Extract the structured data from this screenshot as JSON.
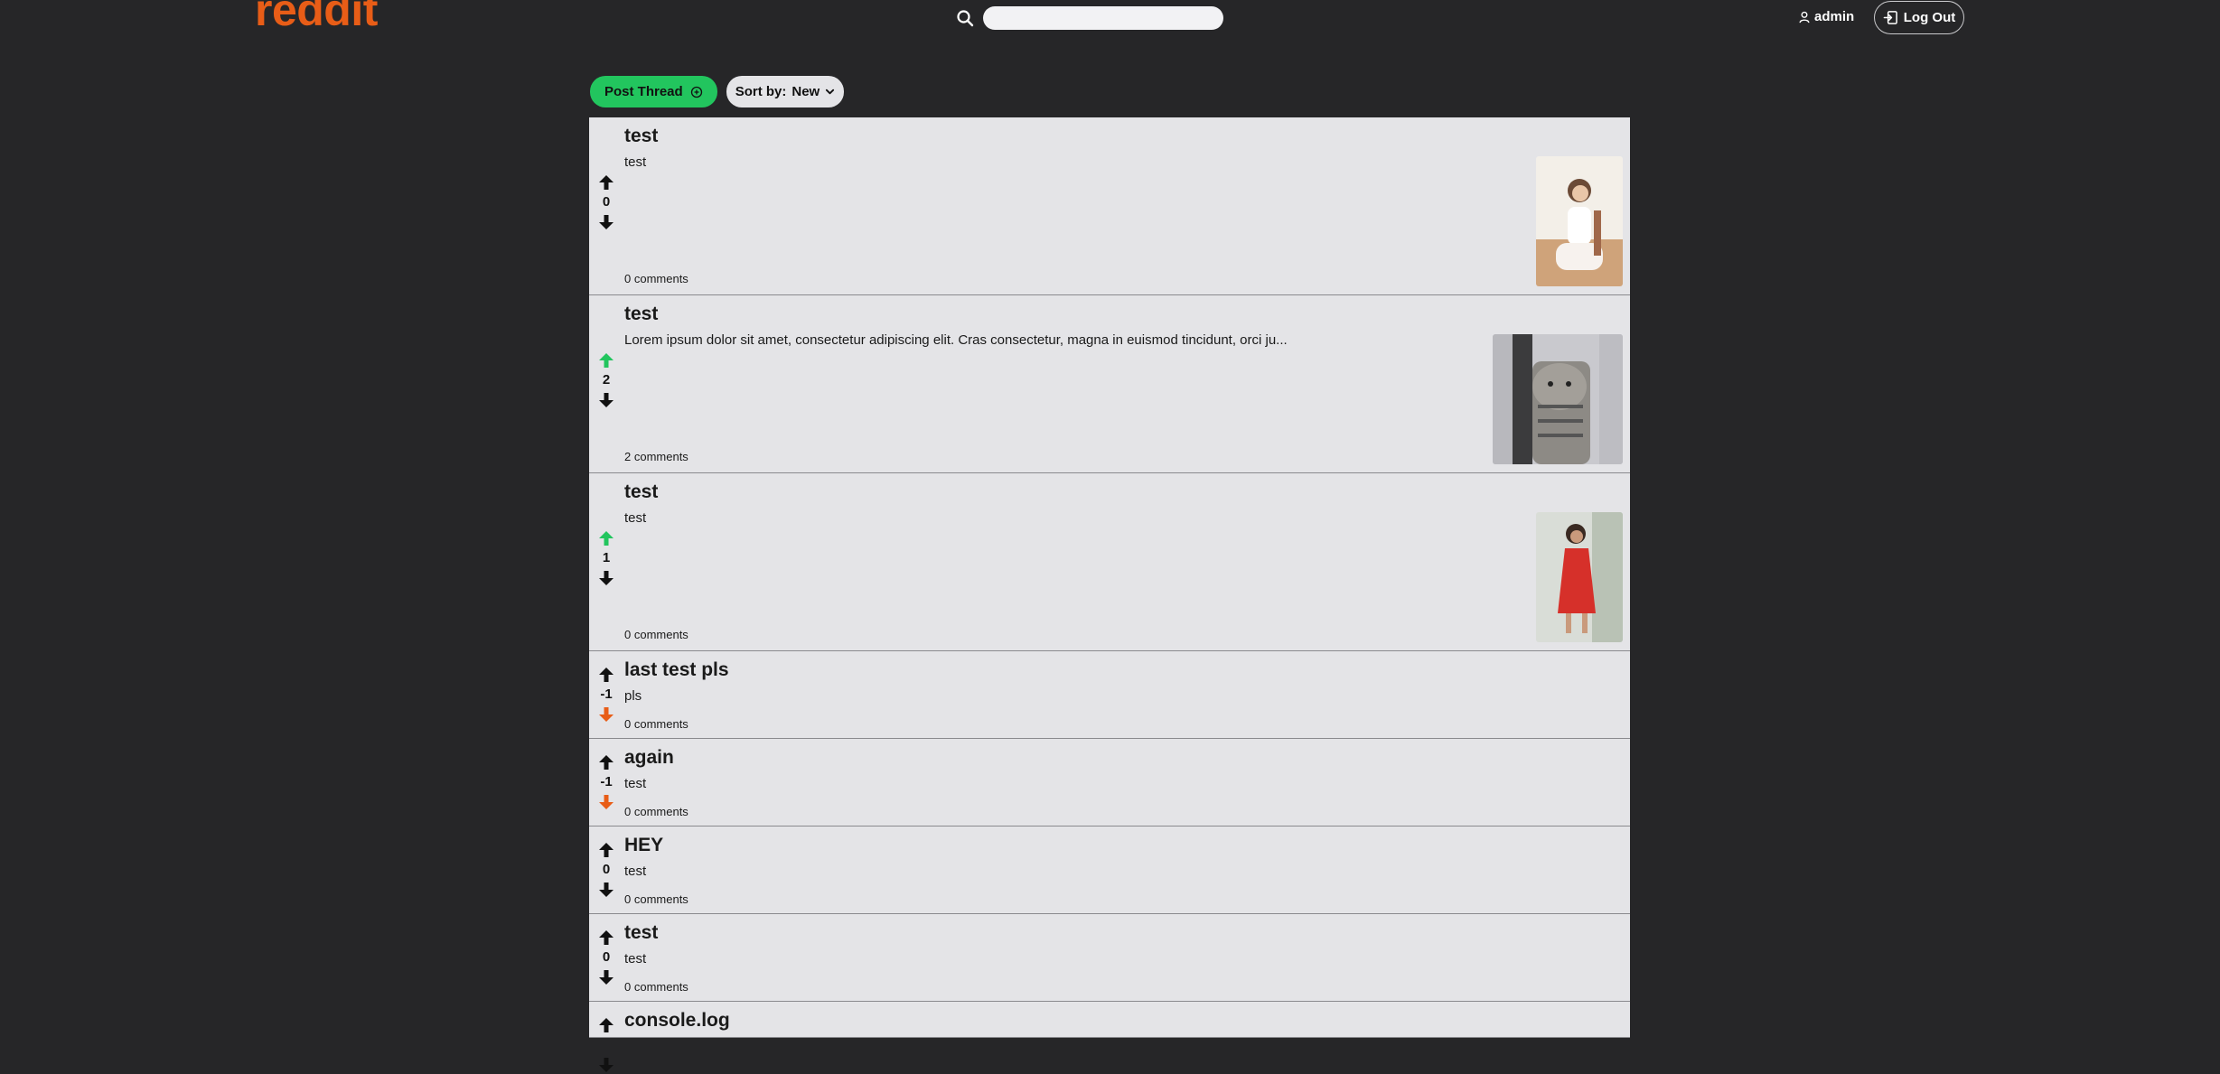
{
  "header": {
    "logo": "reddit",
    "search": {
      "value": "",
      "placeholder": ""
    },
    "username": "admin",
    "logout_label": "Log Out"
  },
  "toolbar": {
    "post_label": "Post Thread",
    "sort_label": "Sort by:",
    "sort_value": "New"
  },
  "colors": {
    "accent": "#e85d17",
    "upvoted": "#22c55e",
    "downvoted": "#e85d17",
    "background": "#262628",
    "card": "#e4e4e7"
  },
  "threads": [
    {
      "title": "test",
      "body": "test",
      "score": "0",
      "vote": "none",
      "comments": "0 comments",
      "thumbnail": "woman-white-dress-photo"
    },
    {
      "title": "test",
      "body": "Lorem ipsum dolor sit amet, consectetur adipiscing elit. Cras consectetur, magna in euismod tincidunt, orci ju...",
      "score": "2",
      "vote": "up",
      "comments": "2 comments",
      "thumbnail": "cat-photo"
    },
    {
      "title": "test",
      "body": "test",
      "score": "1",
      "vote": "up",
      "comments": "0 comments",
      "thumbnail": "woman-red-dress-photo"
    },
    {
      "title": "last test pls",
      "body": "pls",
      "score": "-1",
      "vote": "down",
      "comments": "0 comments"
    },
    {
      "title": "again",
      "body": "test",
      "score": "-1",
      "vote": "down",
      "comments": "0 comments"
    },
    {
      "title": "HEY",
      "body": "test",
      "score": "0",
      "vote": "none",
      "comments": "0 comments"
    },
    {
      "title": "test",
      "body": "test",
      "score": "0",
      "vote": "none",
      "comments": "0 comments"
    },
    {
      "title": "console.log",
      "body": "",
      "score": "",
      "vote": "none",
      "comments": ""
    }
  ]
}
